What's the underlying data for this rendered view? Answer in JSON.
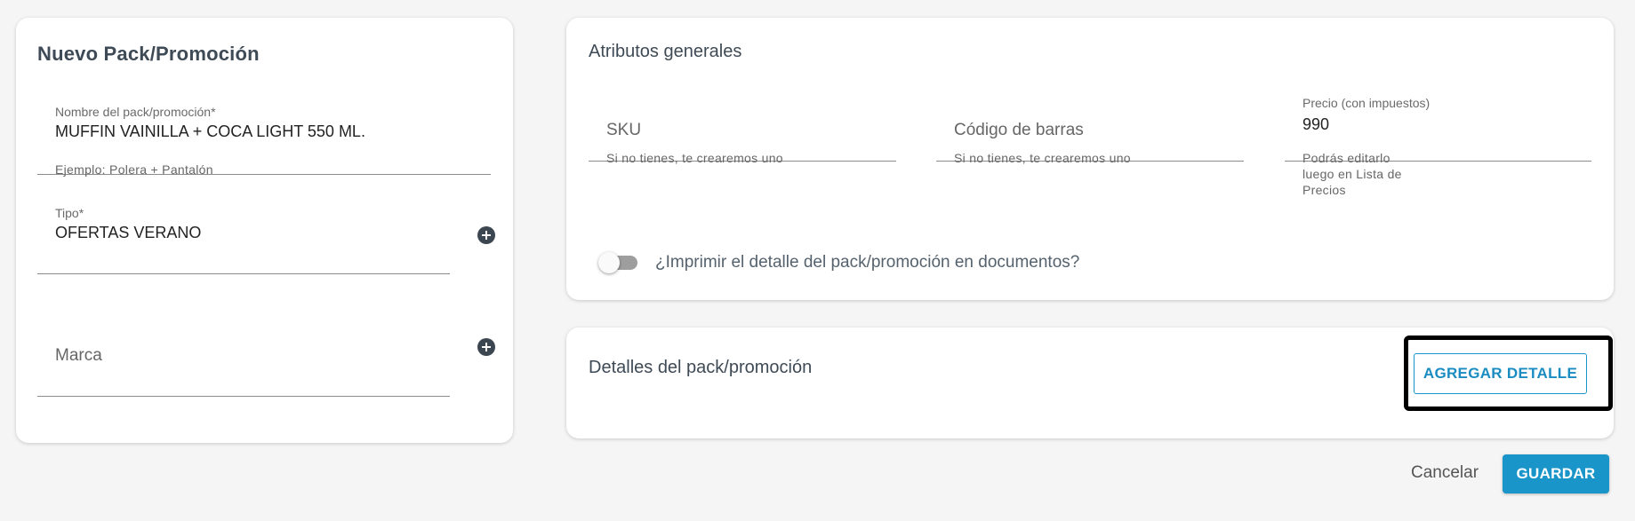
{
  "left_card": {
    "title": "Nuevo Pack/Promoción",
    "name_field": {
      "label": "Nombre del pack/promoción*",
      "value": "MUFFIN VAINILLA + COCA LIGHT 550 ML.",
      "helper": "Ejemplo: Polera + Pantalón"
    },
    "tipo_field": {
      "label": "Tipo*",
      "value": "OFERTAS VERANO"
    },
    "marca_field": {
      "placeholder": "Marca"
    }
  },
  "attributes_card": {
    "title": "Atributos generales",
    "sku": {
      "placeholder": "SKU",
      "helper": "Si no tienes, te crearemos uno"
    },
    "barcode": {
      "placeholder": "Código de barras",
      "helper": "Si no tienes, te crearemos uno"
    },
    "price": {
      "label": "Precio (con impuestos)",
      "value": "990",
      "helper_lines": [
        "Podrás editarlo",
        "luego en Lista de",
        "Precios"
      ]
    },
    "print_toggle": {
      "label": "¿Imprimir el detalle del pack/promoción en documentos?",
      "checked": false
    }
  },
  "details_card": {
    "title": "Detalles del pack/promoción",
    "add_button": "AGREGAR DETALLE"
  },
  "footer": {
    "cancel": "Cancelar",
    "save": "GUARDAR"
  },
  "colors": {
    "accent": "#1a95c9",
    "background": "#f5f5f5",
    "card": "#ffffff",
    "highlight": "#000000"
  }
}
